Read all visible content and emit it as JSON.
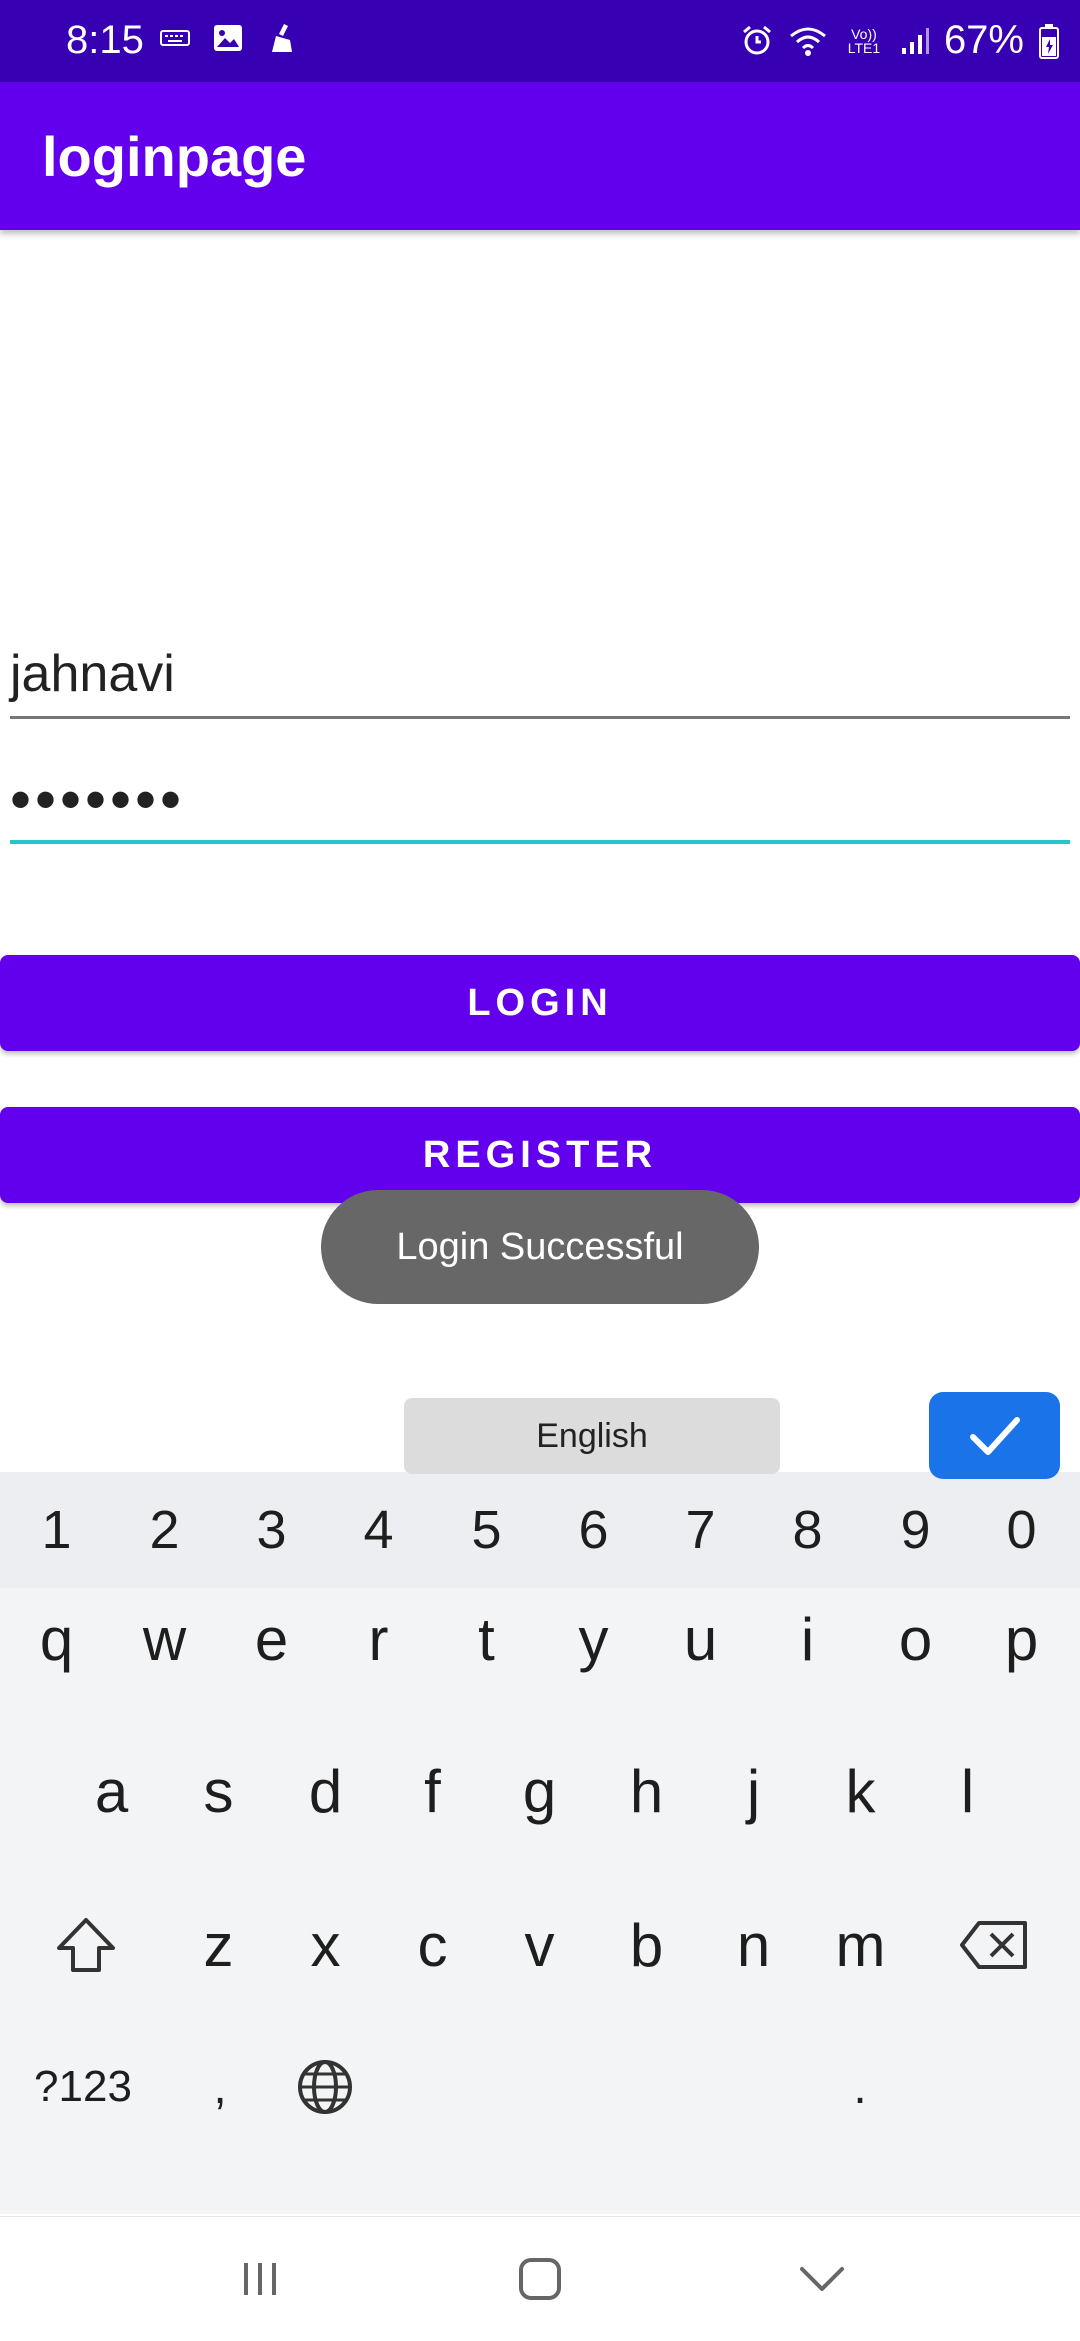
{
  "status_bar": {
    "time": "8:15",
    "battery": "67%",
    "network": "Vo)) LTE1"
  },
  "app_bar": {
    "title": "loginpage"
  },
  "form": {
    "username_value": "jahnavi",
    "password_value": "•••••••",
    "login_label": "LOGIN",
    "register_label": "REGISTER"
  },
  "toast": {
    "message": "Login Successful"
  },
  "keyboard": {
    "numbers": [
      "1",
      "2",
      "3",
      "4",
      "5",
      "6",
      "7",
      "8",
      "9",
      "0"
    ],
    "row1": [
      "q",
      "w",
      "e",
      "r",
      "t",
      "y",
      "u",
      "i",
      "o",
      "p"
    ],
    "row2": [
      "a",
      "s",
      "d",
      "f",
      "g",
      "h",
      "j",
      "k",
      "l"
    ],
    "row3": [
      "z",
      "x",
      "c",
      "v",
      "b",
      "n",
      "m"
    ],
    "symbols_key": "?123",
    "comma_key": ",",
    "period_key": ".",
    "space_label": "English"
  },
  "colors": {
    "primary": "#6200ee",
    "primary_dark": "#3700b3",
    "accent": "#26c6c6",
    "enter_key": "#1a73e8"
  }
}
